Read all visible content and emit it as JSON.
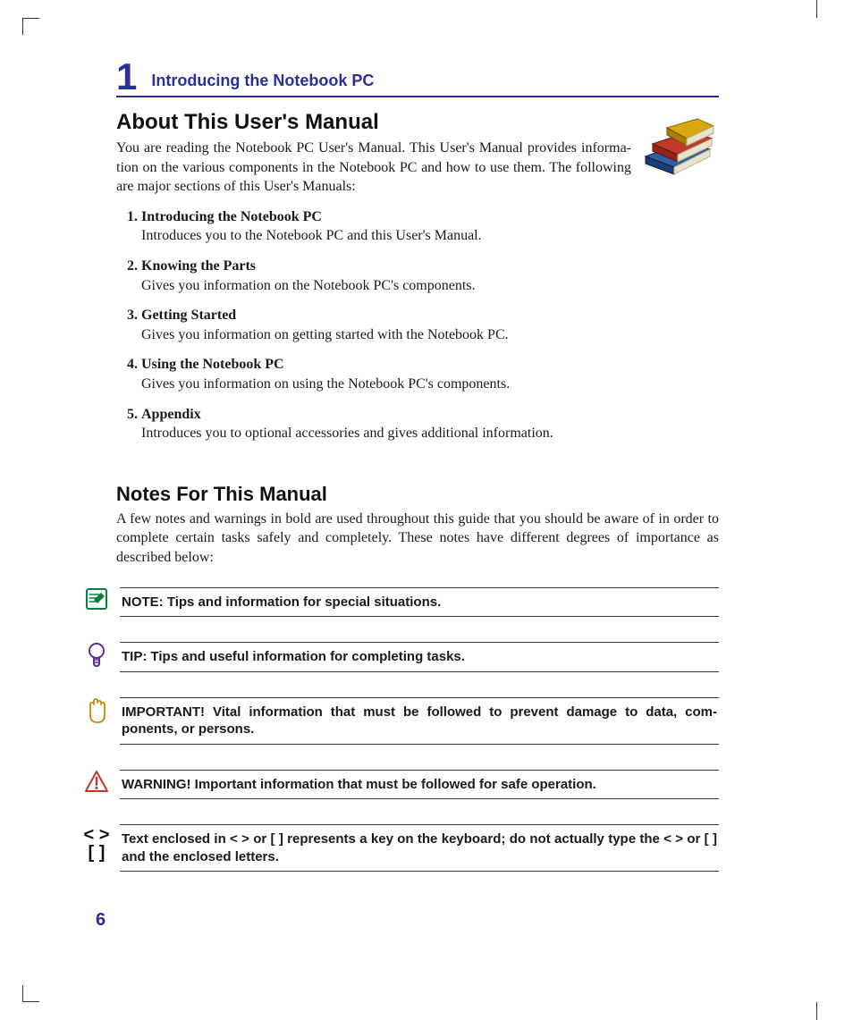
{
  "chapter": {
    "number": "1",
    "title": "Introducing the Notebook PC"
  },
  "section1": {
    "heading": "About This User's Manual",
    "intro": "You are reading the Notebook PC User's Manual. This User's Manual provides informa­tion on the various components in the Notebook PC and how to use them. The following are major sections of this User's Manuals:",
    "items": [
      {
        "title": "Introducing the Notebook PC",
        "desc": "Introduces you to the Notebook PC and this User's Manual."
      },
      {
        "title": "Knowing the Parts",
        "desc": "Gives you information on the Notebook PC's components."
      },
      {
        "title": "Getting Started",
        "desc": "Gives you information on getting started with the Notebook PC."
      },
      {
        "title": "Using the Notebook PC",
        "desc": "Gives you information on using the Notebook PC's components."
      },
      {
        "title": "Appendix",
        "desc": "Introduces you to optional accessories and gives additional information."
      }
    ]
  },
  "section2": {
    "heading": "Notes For This Manual",
    "intro": "A few notes and warnings in bold are used throughout this guide that you should be aware of in order to complete certain tasks safely and completely. These notes have different degrees of importance as described below:"
  },
  "callouts": {
    "note": "NOTE: Tips and information for special situations.",
    "tip": "TIP: Tips and useful information for completing tasks.",
    "important": "IMPORTANT! Vital information that must be followed to prevent damage to data, com­ponents, or persons.",
    "warning": "WARNING! Important information that must be followed for safe operation.",
    "keys_line1": "< >",
    "keys_line2": "[  ]",
    "keys": "Text enclosed in < > or [ ] represents a key on the keyboard; do not actually type the < > or [ ] and the enclosed letters."
  },
  "page_number": "6"
}
